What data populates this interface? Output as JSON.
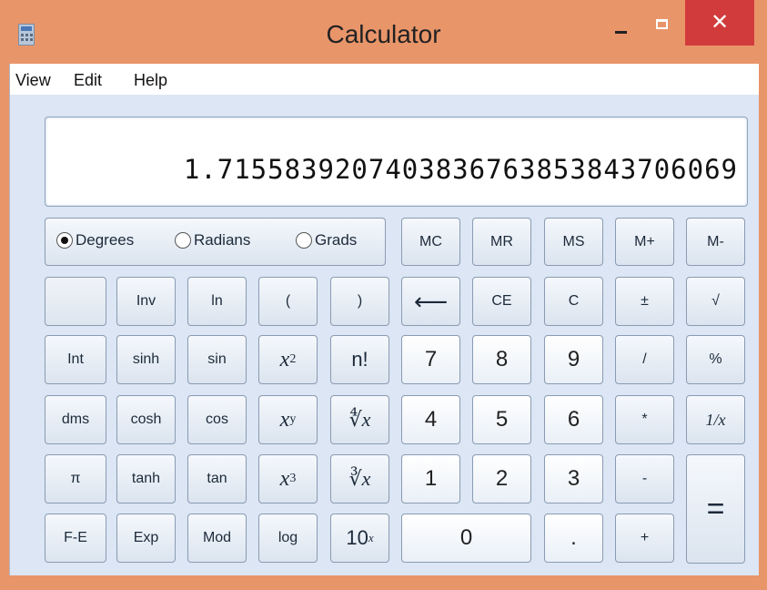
{
  "window": {
    "title": "Calculator",
    "close_glyph": "✕"
  },
  "menu": {
    "view": "View",
    "edit": "Edit",
    "help": "Help"
  },
  "display": {
    "value": "1.7155839207403836763853843706069"
  },
  "angle_modes": {
    "degrees": "Degrees",
    "radians": "Radians",
    "grads": "Grads",
    "selected": "Degrees"
  },
  "memory": {
    "mc": "MC",
    "mr": "MR",
    "ms": "MS",
    "m_plus": "M+",
    "m_minus": "M-"
  },
  "row2": {
    "inv": "Inv",
    "ln": "ln",
    "lparen": "(",
    "rparen": ")",
    "backspace": "⟵",
    "ce": "CE",
    "c": "C",
    "plusminus": "±",
    "sqrt": "√"
  },
  "row3": {
    "int": "Int",
    "sinh": "sinh",
    "sin": "sin",
    "x2": "x",
    "x2_sup": "2",
    "nfact": "n!",
    "n7": "7",
    "n8": "8",
    "n9": "9",
    "div": "/",
    "pct": "%"
  },
  "row4": {
    "dms": "dms",
    "cosh": "cosh",
    "cos": "cos",
    "xy": "x",
    "xy_sup": "y",
    "yroot": "∜x",
    "n4": "4",
    "n5": "5",
    "n6": "6",
    "mul": "*",
    "recip": "1/x"
  },
  "row5": {
    "pi": "π",
    "tanh": "tanh",
    "tan": "tan",
    "x3": "x",
    "x3_sup": "3",
    "cuberoot": "∛x",
    "n1": "1",
    "n2": "2",
    "n3": "3",
    "sub": "-",
    "eq": "="
  },
  "row6": {
    "fe": "F-E",
    "exp": "Exp",
    "mod": "Mod",
    "log": "log",
    "ten": "10",
    "ten_sup": "x",
    "n0": "0",
    "dot": ".",
    "add": "+"
  }
}
